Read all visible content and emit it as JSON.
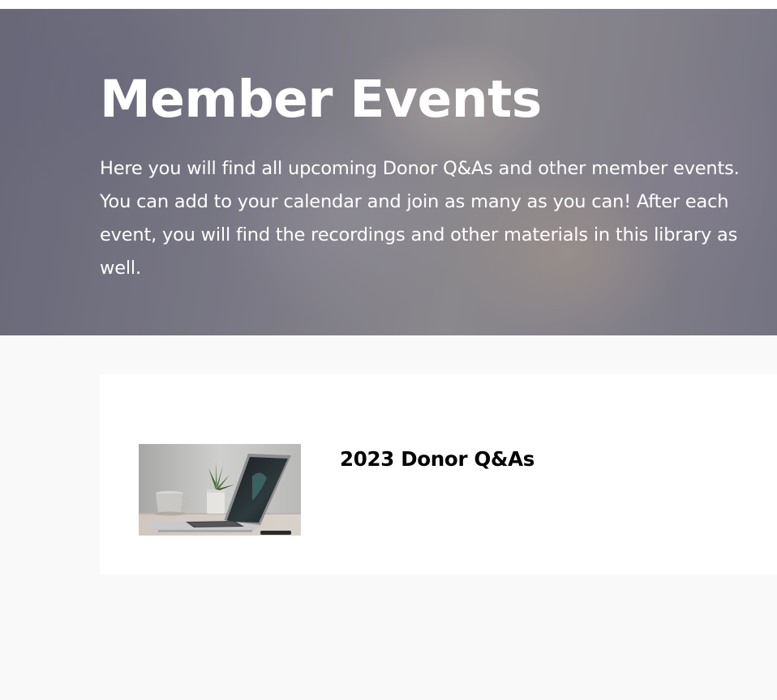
{
  "hero": {
    "title": "Member Events",
    "description": "Here you will find all upcoming Donor Q&As and other member events. You can add to your calendar and join as many as you can! After each event, you will find the recordings and other materials in this library as well."
  },
  "events": [
    {
      "title": "2023 Donor Q&As",
      "thumbnail_icon": "laptop-desk-photo"
    }
  ],
  "colors": {
    "page_background": "#f9f9f9",
    "card_background": "#ffffff",
    "hero_text": "#ffffff",
    "event_title": "#000000"
  }
}
